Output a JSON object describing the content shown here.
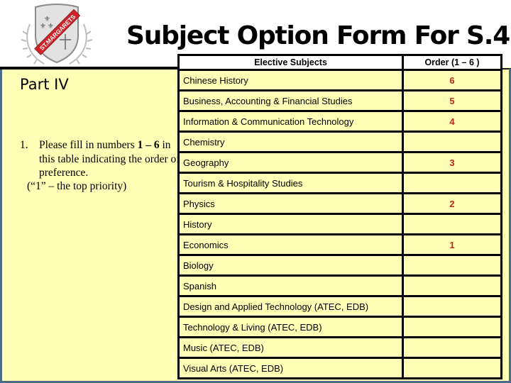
{
  "logo": {
    "name": "St. Margaret's crest",
    "banner_text": "ST.MARGARETS",
    "colors": {
      "banner": "#d3232a",
      "shield": "#d9d9d9",
      "laurel": "#bfbfbf"
    }
  },
  "title": "Subject Option Form For S.4",
  "part_heading": "Part IV",
  "instruction": {
    "number": "1.",
    "text_before": "Please fill in numbers ",
    "range": "1 – 6",
    "text_after": " in this table indicating the order of preference.",
    "note": "(“1” – the top priority)"
  },
  "table": {
    "headers": {
      "subject": "Elective Subjects",
      "order": "Order (1 – 6 )"
    },
    "rows": [
      {
        "subject": "Chinese History",
        "order": "6"
      },
      {
        "subject": "Business, Accounting & Financial Studies",
        "order": "5"
      },
      {
        "subject": "Information &  Communication Technology",
        "order": "4"
      },
      {
        "subject": "Chemistry",
        "order": ""
      },
      {
        "subject": "Geography",
        "order": "3"
      },
      {
        "subject": "Tourism & Hospitality Studies",
        "order": ""
      },
      {
        "subject": "Physics",
        "order": "2"
      },
      {
        "subject": "History",
        "order": ""
      },
      {
        "subject": "Economics",
        "order": "1"
      },
      {
        "subject": "Biology",
        "order": ""
      },
      {
        "subject": "Spanish",
        "order": ""
      },
      {
        "subject": "Design and Applied Technology (ATEC, EDB)",
        "order": ""
      },
      {
        "subject": "Technology & Living (ATEC, EDB)",
        "order": ""
      },
      {
        "subject": "Music (ATEC, EDB)",
        "order": ""
      },
      {
        "subject": "Visual Arts (ATEC, EDB)",
        "order": ""
      }
    ]
  },
  "colors": {
    "panel_background": "#ffffb6",
    "order_value": "#c0281e",
    "frame": "#4a6b86"
  }
}
